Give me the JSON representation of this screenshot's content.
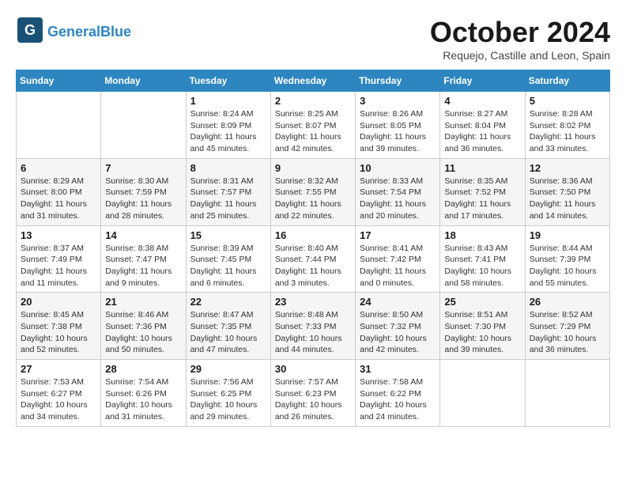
{
  "header": {
    "logo_line1": "General",
    "logo_line2": "Blue",
    "month_title": "October 2024",
    "location": "Requejo, Castille and Leon, Spain"
  },
  "days_of_week": [
    "Sunday",
    "Monday",
    "Tuesday",
    "Wednesday",
    "Thursday",
    "Friday",
    "Saturday"
  ],
  "weeks": [
    [
      {
        "day": "",
        "detail": ""
      },
      {
        "day": "",
        "detail": ""
      },
      {
        "day": "1",
        "detail": "Sunrise: 8:24 AM\nSunset: 8:09 PM\nDaylight: 11 hours and 45 minutes."
      },
      {
        "day": "2",
        "detail": "Sunrise: 8:25 AM\nSunset: 8:07 PM\nDaylight: 11 hours and 42 minutes."
      },
      {
        "day": "3",
        "detail": "Sunrise: 8:26 AM\nSunset: 8:05 PM\nDaylight: 11 hours and 39 minutes."
      },
      {
        "day": "4",
        "detail": "Sunrise: 8:27 AM\nSunset: 8:04 PM\nDaylight: 11 hours and 36 minutes."
      },
      {
        "day": "5",
        "detail": "Sunrise: 8:28 AM\nSunset: 8:02 PM\nDaylight: 11 hours and 33 minutes."
      }
    ],
    [
      {
        "day": "6",
        "detail": "Sunrise: 8:29 AM\nSunset: 8:00 PM\nDaylight: 11 hours and 31 minutes."
      },
      {
        "day": "7",
        "detail": "Sunrise: 8:30 AM\nSunset: 7:59 PM\nDaylight: 11 hours and 28 minutes."
      },
      {
        "day": "8",
        "detail": "Sunrise: 8:31 AM\nSunset: 7:57 PM\nDaylight: 11 hours and 25 minutes."
      },
      {
        "day": "9",
        "detail": "Sunrise: 8:32 AM\nSunset: 7:55 PM\nDaylight: 11 hours and 22 minutes."
      },
      {
        "day": "10",
        "detail": "Sunrise: 8:33 AM\nSunset: 7:54 PM\nDaylight: 11 hours and 20 minutes."
      },
      {
        "day": "11",
        "detail": "Sunrise: 8:35 AM\nSunset: 7:52 PM\nDaylight: 11 hours and 17 minutes."
      },
      {
        "day": "12",
        "detail": "Sunrise: 8:36 AM\nSunset: 7:50 PM\nDaylight: 11 hours and 14 minutes."
      }
    ],
    [
      {
        "day": "13",
        "detail": "Sunrise: 8:37 AM\nSunset: 7:49 PM\nDaylight: 11 hours and 11 minutes."
      },
      {
        "day": "14",
        "detail": "Sunrise: 8:38 AM\nSunset: 7:47 PM\nDaylight: 11 hours and 9 minutes."
      },
      {
        "day": "15",
        "detail": "Sunrise: 8:39 AM\nSunset: 7:45 PM\nDaylight: 11 hours and 6 minutes."
      },
      {
        "day": "16",
        "detail": "Sunrise: 8:40 AM\nSunset: 7:44 PM\nDaylight: 11 hours and 3 minutes."
      },
      {
        "day": "17",
        "detail": "Sunrise: 8:41 AM\nSunset: 7:42 PM\nDaylight: 11 hours and 0 minutes."
      },
      {
        "day": "18",
        "detail": "Sunrise: 8:43 AM\nSunset: 7:41 PM\nDaylight: 10 hours and 58 minutes."
      },
      {
        "day": "19",
        "detail": "Sunrise: 8:44 AM\nSunset: 7:39 PM\nDaylight: 10 hours and 55 minutes."
      }
    ],
    [
      {
        "day": "20",
        "detail": "Sunrise: 8:45 AM\nSunset: 7:38 PM\nDaylight: 10 hours and 52 minutes."
      },
      {
        "day": "21",
        "detail": "Sunrise: 8:46 AM\nSunset: 7:36 PM\nDaylight: 10 hours and 50 minutes."
      },
      {
        "day": "22",
        "detail": "Sunrise: 8:47 AM\nSunset: 7:35 PM\nDaylight: 10 hours and 47 minutes."
      },
      {
        "day": "23",
        "detail": "Sunrise: 8:48 AM\nSunset: 7:33 PM\nDaylight: 10 hours and 44 minutes."
      },
      {
        "day": "24",
        "detail": "Sunrise: 8:50 AM\nSunset: 7:32 PM\nDaylight: 10 hours and 42 minutes."
      },
      {
        "day": "25",
        "detail": "Sunrise: 8:51 AM\nSunset: 7:30 PM\nDaylight: 10 hours and 39 minutes."
      },
      {
        "day": "26",
        "detail": "Sunrise: 8:52 AM\nSunset: 7:29 PM\nDaylight: 10 hours and 36 minutes."
      }
    ],
    [
      {
        "day": "27",
        "detail": "Sunrise: 7:53 AM\nSunset: 6:27 PM\nDaylight: 10 hours and 34 minutes."
      },
      {
        "day": "28",
        "detail": "Sunrise: 7:54 AM\nSunset: 6:26 PM\nDaylight: 10 hours and 31 minutes."
      },
      {
        "day": "29",
        "detail": "Sunrise: 7:56 AM\nSunset: 6:25 PM\nDaylight: 10 hours and 29 minutes."
      },
      {
        "day": "30",
        "detail": "Sunrise: 7:57 AM\nSunset: 6:23 PM\nDaylight: 10 hours and 26 minutes."
      },
      {
        "day": "31",
        "detail": "Sunrise: 7:58 AM\nSunset: 6:22 PM\nDaylight: 10 hours and 24 minutes."
      },
      {
        "day": "",
        "detail": ""
      },
      {
        "day": "",
        "detail": ""
      }
    ]
  ]
}
